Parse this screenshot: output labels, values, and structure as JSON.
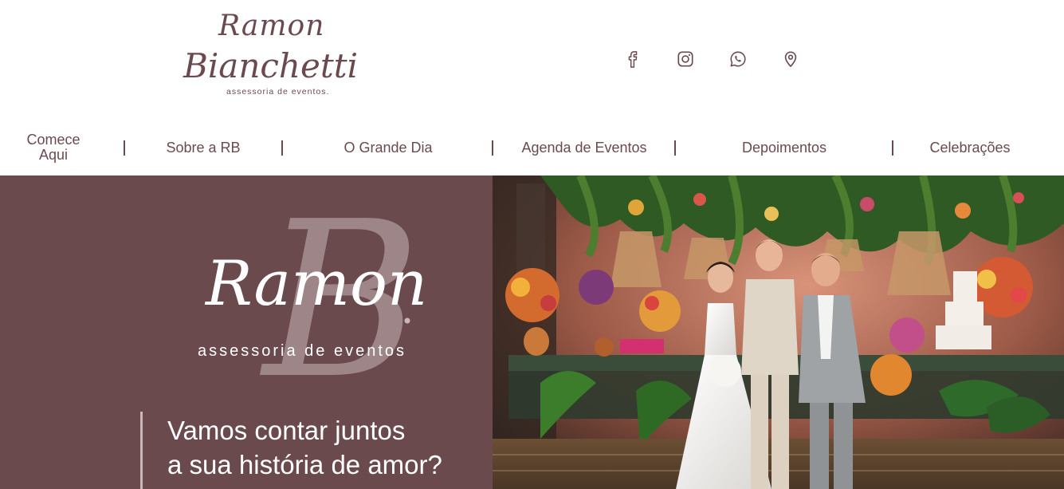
{
  "logo": {
    "first_name": "Ramon",
    "last_name": "Bianchetti",
    "tagline": "assessoria de eventos."
  },
  "social": [
    {
      "name": "facebook-icon",
      "label": "f"
    },
    {
      "name": "instagram-icon"
    },
    {
      "name": "whatsapp-icon"
    },
    {
      "name": "location-icon"
    }
  ],
  "nav": {
    "items": [
      {
        "label": "Comece\nAqui"
      },
      {
        "label": "Sobre a RB"
      },
      {
        "label": "O Grande Dia"
      },
      {
        "label": "Agenda de Eventos"
      },
      {
        "label": "Depoimentos"
      },
      {
        "label": "Celebrações"
      }
    ]
  },
  "hero": {
    "monogram": "RB",
    "script_name": "Ramon",
    "tagline": "assessoria de eventos",
    "headline_line1": "Vamos contar juntos",
    "headline_line2": "a sua história de amor?"
  },
  "colors": {
    "brand": "#6b4a4f",
    "hero_bg": "#6b4a4d"
  }
}
